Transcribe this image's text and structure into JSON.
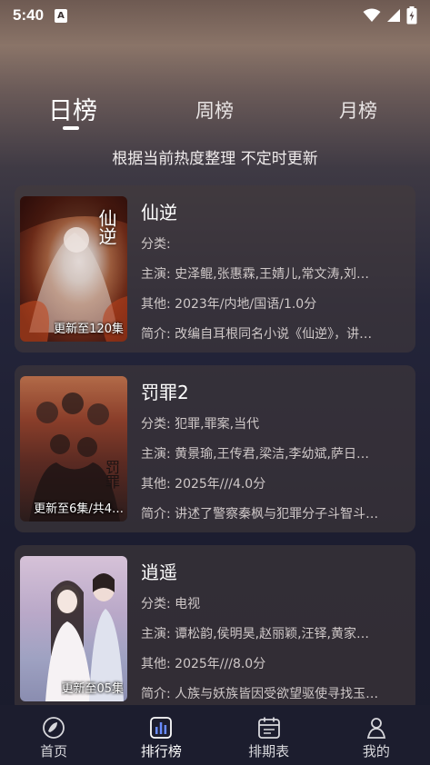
{
  "status_bar": {
    "time": "5:40",
    "notification_icon": "A"
  },
  "tabs": [
    {
      "label": "日榜",
      "active": true
    },
    {
      "label": "周榜",
      "active": false
    },
    {
      "label": "月榜",
      "active": false
    }
  ],
  "subtitle": "根据当前热度整理 不定时更新",
  "items": [
    {
      "title": "仙逆",
      "category": "分类:",
      "cast": "主演: 史泽鲲,张惠霖,王婧儿,常文涛,刘…",
      "other": "其他: 2023年/内地/国语/1.0分",
      "intro": "简介: 改编自耳根同名小说《仙逆》，讲…",
      "badge": "更新至120集",
      "poster_label": "仙逆"
    },
    {
      "title": "罚罪2",
      "category": "分类: 犯罪,罪案,当代",
      "cast": "主演: 黄景瑜,王传君,梁洁,李幼斌,萨日…",
      "other": "其他: 2025年///4.0分",
      "intro": "简介: 讲述了警察秦枫与犯罪分子斗智斗…",
      "badge": "更新至6集/共4…",
      "poster_label": "罚罪"
    },
    {
      "title": "逍遥",
      "category": "分类: 电视",
      "cast": "主演: 谭松韵,侯明昊,赵丽颖,汪铎,黄家…",
      "other": "其他: 2025年///8.0分",
      "intro": "简介: 人族与妖族皆因受欲望驱使寻找玉…",
      "badge": "更新至05集",
      "poster_label": ""
    }
  ],
  "nav": [
    {
      "label": "首页",
      "icon": "home-icon",
      "active": false
    },
    {
      "label": "排行榜",
      "icon": "ranking-icon",
      "active": true
    },
    {
      "label": "排期表",
      "icon": "calendar-icon",
      "active": false
    },
    {
      "label": "我的",
      "icon": "profile-icon",
      "active": false
    }
  ]
}
